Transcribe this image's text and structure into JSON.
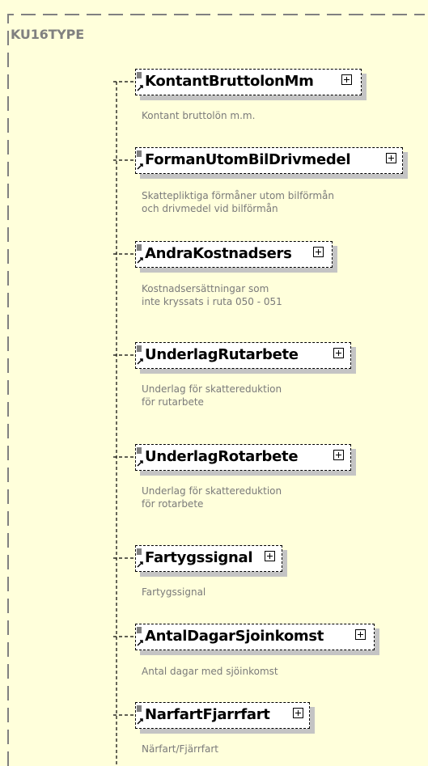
{
  "type_name": "KU16TYPE",
  "colors": {
    "background": "#ffffdb",
    "border": "#808080",
    "shadow": "#c4c4c4",
    "description": "#7a7a7a"
  },
  "elements": [
    {
      "name": "KontantBruttolonMm",
      "description": "Kontant bruttolön m.m."
    },
    {
      "name": "FormanUtomBilDrivmedel",
      "description": "Skattepliktiga förmåner utom bilförmån\noch drivmedel vid bilförmån"
    },
    {
      "name": "AndraKostnadsers",
      "description": "Kostnadsersättningar som\ninte kryssats i ruta 050 - 051"
    },
    {
      "name": "UnderlagRutarbete",
      "description": "Underlag för skattereduktion\nför rutarbete"
    },
    {
      "name": "UnderlagRotarbete",
      "description": "Underlag för skattereduktion\nför rotarbete"
    },
    {
      "name": "Fartygssignal",
      "description": "Fartygssignal"
    },
    {
      "name": "AntalDagarSjoinkomst",
      "description": "Antal dagar med sjöinkomst"
    },
    {
      "name": "NarfartFjarrfart",
      "description": "Närfart/Fjärrfart"
    }
  ]
}
